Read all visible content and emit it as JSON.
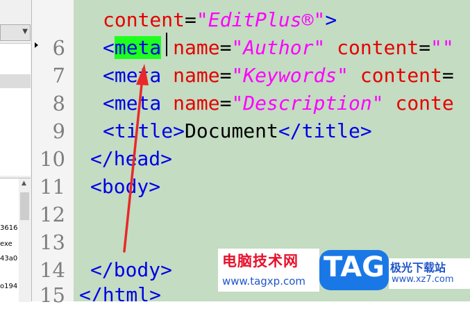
{
  "file_panel": {
    "file_items": [
      "3616",
      "exe",
      "43a0",
      "o194"
    ]
  },
  "gutter": {
    "line_numbers": [
      "6",
      "7",
      "8",
      "9",
      "10",
      "11",
      "12",
      "13",
      "14",
      "15"
    ]
  },
  "editor": {
    "line5": {
      "attr": "content",
      "eq": "=",
      "value": "\"EditPlus®\"",
      "close": ">"
    },
    "line6": {
      "open": "<",
      "tag": "meta",
      "attr1": "name",
      "eq1": "=",
      "val1": "\"Author\"",
      "attr2": "content",
      "eq2": "=",
      "val2": "\"\""
    },
    "line7": {
      "open": "<",
      "tag": "meta",
      "attr1": "name",
      "eq1": "=",
      "val1": "\"Keywords\"",
      "attr2": "content",
      "eq2": "="
    },
    "line8": {
      "open": "<",
      "tag": "meta",
      "attr1": "name",
      "eq1": "=",
      "val1": "\"Description\"",
      "attr2": "conte"
    },
    "line9": {
      "open": "<title>",
      "text": "Document",
      "close": "</title>"
    },
    "line10": {
      "text": "</head>"
    },
    "line11": {
      "text": "<body>"
    },
    "line14": {
      "text": "</body>"
    },
    "line15": {
      "text": "</html>"
    }
  },
  "watermark": {
    "cn_title": "电脑技术网",
    "url": "www.tagxp.com",
    "badge": "TAG",
    "site_name": "极光下载站",
    "site_domain": "www.xz7.com"
  },
  "colors": {
    "code_background": "#c3dcc2",
    "tag": "#0000e6",
    "attribute": "#e60000",
    "value": "#ff00ff",
    "highlight": "#1eff1e",
    "arrow": "#e8282a"
  }
}
